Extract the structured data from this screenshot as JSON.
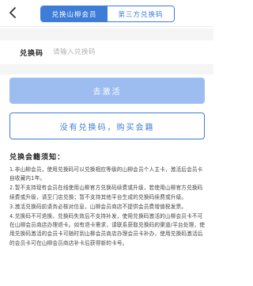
{
  "header": {
    "tabs": [
      {
        "label": "兑换山柳会员",
        "active": true
      },
      {
        "label": "第三方兑换码",
        "active": false
      }
    ]
  },
  "form": {
    "code_label": "兑换码",
    "code_placeholder": "请输入兑换码",
    "code_value": ""
  },
  "actions": {
    "redeem_label": "去激活",
    "buy_label": "没有兑换码，购买会籍"
  },
  "notes": {
    "title": "兑换会籍须知：",
    "items": [
      "1.非山柳会员，使用兑换码可以兑换相应等级的山柳会员个人主卡，激活后会员卡自收藏内1年。",
      "2.暂不支持现有会员在线使用山柳官方兑换码续费或升级，若使用山柳官方兑换码续费或升级，请至门店兑换；暂不支持其他平台生成的兑换码续费或升级。",
      "3.激活兑换码前请务必核对信息，山柳会员商店不提供会员费增值税发票。",
      "4.兑换码不可退换，兑换码失效后不支持补发，使用兑换码激活的山柳会员卡不可在山柳会员商店办理退卡。如有退卡需求，请联系获取兑换码的渠道/平台处理，使用兑换码激活的会员卡可随时到山柳会员商店办理会员卡补办，使用兑换码激活后的会员卡可在山柳会员商店补卡后获得新的卡号。"
    ]
  }
}
